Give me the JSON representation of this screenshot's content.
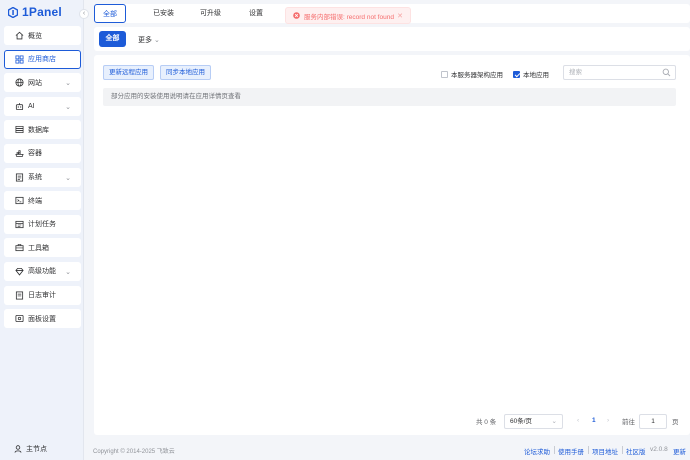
{
  "app": {
    "name": "1Panel",
    "brand_color": "#1d5bd8",
    "error_color": "#f56c6c"
  },
  "sidebar": {
    "items": [
      {
        "label": "概览",
        "icon": "home-icon",
        "active": false,
        "expandable": false
      },
      {
        "label": "应用商店",
        "icon": "grid-icon",
        "active": true,
        "expandable": false
      },
      {
        "label": "网站",
        "icon": "globe-icon",
        "active": false,
        "expandable": true
      },
      {
        "label": "AI",
        "icon": "robot-icon",
        "active": false,
        "expandable": true
      },
      {
        "label": "数据库",
        "icon": "database-icon",
        "active": false,
        "expandable": false
      },
      {
        "label": "容器",
        "icon": "container-icon",
        "active": false,
        "expandable": false
      },
      {
        "label": "系统",
        "icon": "system-icon",
        "active": false,
        "expandable": true
      },
      {
        "label": "终端",
        "icon": "terminal-icon",
        "active": false,
        "expandable": false
      },
      {
        "label": "计划任务",
        "icon": "task-icon",
        "active": false,
        "expandable": false
      },
      {
        "label": "工具箱",
        "icon": "toolbox-icon",
        "active": false,
        "expandable": false
      },
      {
        "label": "高级功能",
        "icon": "diamond-icon",
        "active": false,
        "expandable": true
      },
      {
        "label": "日志审计",
        "icon": "log-icon",
        "active": false,
        "expandable": false
      },
      {
        "label": "面板设置",
        "icon": "settings-icon",
        "active": false,
        "expandable": false
      }
    ],
    "node_label": "主节点"
  },
  "tabs": [
    {
      "label": "全部",
      "active": true
    },
    {
      "label": "已安装",
      "active": false
    },
    {
      "label": "可升级",
      "active": false
    },
    {
      "label": "设置",
      "active": false
    }
  ],
  "toast": {
    "message": "服务内部错误: record not found",
    "type": "error"
  },
  "filter": {
    "all_label": "全部",
    "more_label": "更多"
  },
  "panel": {
    "sync_remote_label": "更新远程应用",
    "sync_local_label": "同步本地应用",
    "arch_filter": {
      "label": "本服务器架构应用",
      "checked": false
    },
    "local_filter": {
      "label": "本地应用",
      "checked": true
    },
    "search": {
      "placeholder": "搜索",
      "value": ""
    },
    "notice": "部分应用的安装使用说明请在应用详情页查看"
  },
  "pagination": {
    "total_text": "共 0 条",
    "page_size": "60条/页",
    "current_page": "1",
    "goto_label": "前往",
    "goto_value": "1",
    "page_unit": "页"
  },
  "footer": {
    "copyright": "Copyright © 2014-2025 飞致云",
    "links": [
      "论坛求助",
      "使用手册",
      "项目地址"
    ],
    "edition": "社区版",
    "version": "v2.0.8",
    "update_label": "更新"
  }
}
